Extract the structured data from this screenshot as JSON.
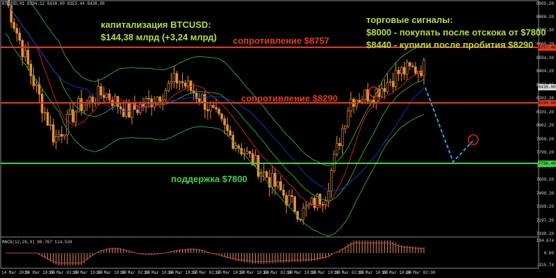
{
  "header": {
    "symbol_info": "BTCUSD,H1  8394.12 8438.00 8353.44 8438.00"
  },
  "annotations": {
    "capitalization_line1": "капитализация BTCUSD:",
    "capitalization_line2": "$144,38 млрд (+3,24 млрд)",
    "signals_title": "торговые сигналы:",
    "signal_1": "$8000 - покупать после отскока от $7800",
    "signal_2": "$8440 - купили после пробития $8290",
    "resistance_top": "сопротивление $8757",
    "resistance_mid": "сопротивление $8290",
    "support": "поддержка $7800"
  },
  "colors": {
    "annotation_text": "#b6e03a",
    "resistance": "#e83a1e",
    "support": "#3fd43f",
    "bull_candle": "#e8903a",
    "bear_candle": "#e8903a",
    "forecast": "#29a3e0"
  },
  "price_axis": {
    "ticks": [
      "8905.20",
      "8806.20",
      "8707.30",
      "8605.20",
      "8504.20",
      "8404.20",
      "8303.20",
      "8203.20",
      "8101.20",
      "8002.20",
      "7900.20",
      "7799.20",
      "7699.20",
      "7600.20",
      "7498.20",
      "7399.20",
      "7297.20",
      "7198.20"
    ],
    "current_price_box": "8438.00",
    "level_boxes": {
      "resistance_top": "8757.40",
      "resistance_mid": "8290.00",
      "support": "7798.40"
    }
  },
  "macd": {
    "label": "MACD(12,26,9) 98.767 114.534",
    "ticks": [
      "194.674",
      "0.00",
      "-315.74"
    ]
  },
  "time_axis": {
    "ticks": [
      "14 Mar 2018",
      "14 Mar 18:00",
      "15 Mar 02:00",
      "15 Mar 10:00",
      "15 Mar 18:00",
      "16 Mar 02:00",
      "16 Mar 10:00",
      "16 Mar 18:00",
      "17 Mar 02:00",
      "17 Mar 10:00",
      "17 Mar 18:00",
      "18 Mar 02:00",
      "18 Mar 10:00",
      "18 Mar 18:00",
      "19 Mar 02:00",
      "19 Mar 10:00",
      "19 Mar 18:00",
      "20 Mar 02:00"
    ]
  },
  "chart_data": {
    "type": "line",
    "title": "BTCUSD,H1",
    "x": [
      "14 Mar 2018",
      "14 Mar 18:00",
      "15 Mar 02:00",
      "15 Mar 10:00",
      "15 Mar 18:00",
      "16 Mar 02:00",
      "16 Mar 10:00",
      "16 Mar 18:00",
      "17 Mar 02:00",
      "17 Mar 10:00",
      "17 Mar 18:00",
      "18 Mar 02:00",
      "18 Mar 10:00",
      "18 Mar 18:00",
      "19 Mar 02:00",
      "19 Mar 10:00",
      "19 Mar 18:00",
      "20 Mar 02:00"
    ],
    "series": [
      {
        "values": [
          8950,
          8400,
          7900,
          8150,
          8250,
          8100,
          8200,
          8350,
          8200,
          7950,
          7750,
          7550,
          7350,
          7500,
          8200,
          8250,
          8400,
          8438
        ]
      }
    ],
    "levels": [
      8757.4,
      8290.0,
      7798.4
    ],
    "ylim": [
      7198.2,
      8905.2
    ],
    "grid": true
  }
}
